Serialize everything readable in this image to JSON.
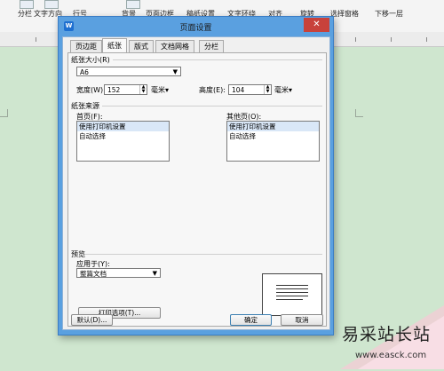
{
  "ribbon": {
    "items": [
      "分栏",
      "文字方向",
      "行号",
      "背景",
      "页面边框",
      "稿纸设置",
      "文字环绕",
      "对齐",
      "旋转",
      "选择窗格",
      "下移一层"
    ]
  },
  "dialog": {
    "title": "页面设置",
    "close": "✕",
    "app_icon": "W",
    "tabs": [
      "页边距",
      "纸张",
      "版式",
      "文档网格",
      "分栏"
    ],
    "active_tab": "纸张",
    "paper_size": {
      "group_label": "纸张大小(R)",
      "selected": "A6",
      "width_label": "宽度(W):",
      "width_value": "152",
      "width_unit": "毫米▾",
      "height_label": "高度(E):",
      "height_value": "104",
      "height_unit": "毫米▾"
    },
    "paper_source": {
      "group_label": "纸张来源",
      "first_page_label": "首页(F):",
      "first_page_items": [
        "使用打印机设置",
        "自动选择"
      ],
      "other_pages_label": "其他页(O):",
      "other_pages_items": [
        "使用打印机设置",
        "自动选择"
      ]
    },
    "preview": {
      "group_label": "预览",
      "apply_to_label": "应用于(Y):",
      "apply_to_value": "整篇文档"
    },
    "print_options_button": "打印选项(T)...",
    "default_button": "默认(D)...",
    "ok_button": "确定",
    "cancel_button": "取消"
  },
  "watermark": {
    "text": "易采站长站",
    "url": "www.easck.com"
  }
}
